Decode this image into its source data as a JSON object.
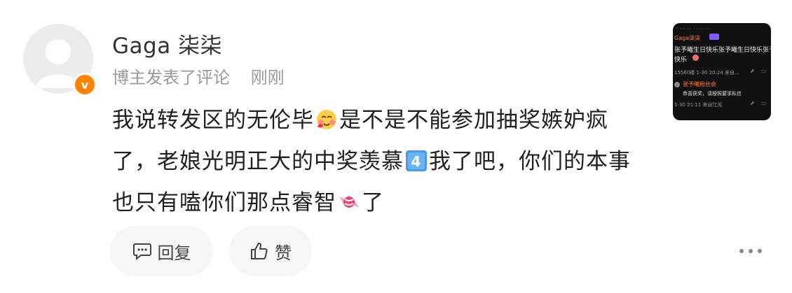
{
  "comment": {
    "username": "Gaga 柒柒",
    "meta_label": "博主发表了评论",
    "time": "刚刚",
    "verified_badge": "v",
    "text_segments": [
      "我说转发区的无伦毕",
      "是不是不能参加抽奖嫉妒疯了，老娘光明正大的中奖羡慕",
      "我了吧，你们的本事也只有嗑你们那点睿智",
      "了"
    ],
    "emojis": [
      "blushing-face-emoji",
      "keycap-4-emoji",
      "candy-emoji"
    ]
  },
  "actions": {
    "reply_label": "回复",
    "like_label": "赞"
  },
  "colors": {
    "verified": "#ff8200",
    "meta_text": "#9a9a9a",
    "button_bg": "#f6f6f6"
  },
  "thumbnail": {
    "lines": [
      "Gaga柒柒",
      "张予曦生日快乐张予曦生日快乐张予",
      "快乐",
      "15560楼 1-30 20:24 来自...",
      "张予曦粉丝会",
      "恭喜获奖，请按照要求私信",
      "1-30 21:11 来自江苏"
    ]
  }
}
